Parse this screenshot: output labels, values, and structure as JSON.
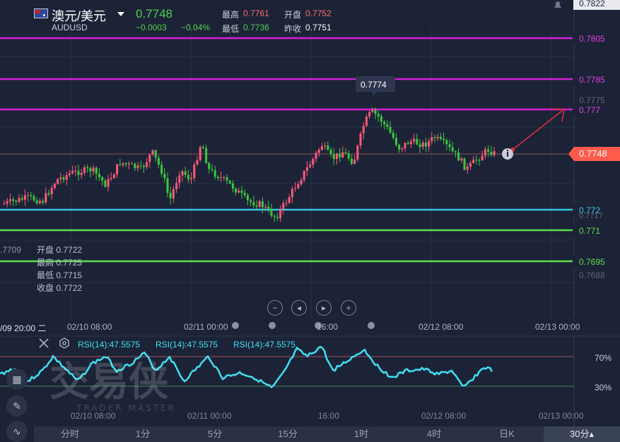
{
  "header": {
    "symbol_name": "澳元/美元",
    "symbol_code": "AUDUSD",
    "price": "0.7748",
    "change": "−0.0003",
    "change_pct": "−0.04%",
    "high_label": "最高",
    "high_value": "0.7761",
    "open_label": "开盘",
    "open_value": "0.7752",
    "low_label": "最低",
    "low_value": "0.7736",
    "prev_close_label": "昨收",
    "prev_close_value": "0.7751"
  },
  "price_axis": {
    "top_label": "0.7822",
    "lines": [
      {
        "label": "0.7805",
        "color": "#d61ed6"
      },
      {
        "label": "0.7785",
        "color": "#d61ed6"
      },
      {
        "label": "0.777",
        "color": "#d61ed6"
      },
      {
        "label": "0.772",
        "color": "#37c8e6"
      },
      {
        "label": "0.771",
        "color": "#5ee04a"
      },
      {
        "label": "0.7695",
        "color": "#5ee04a"
      }
    ],
    "faint_labels": [
      "0.7775",
      "0.7717",
      "0.7688"
    ],
    "current_price": "0.7748",
    "peak_tooltip": "0.7774",
    "left_edge_label": ".7709"
  },
  "ohlc_tooltip": {
    "open": "开盘 0.7722",
    "high": "最高 0.7725",
    "low": "最低 0.7715",
    "close": "收盘 0.7722"
  },
  "time_axis_top": [
    "/09 20:00 二",
    "02/10 08:00",
    "02/11 00:00",
    "16:00",
    "02/12 08:00",
    "02/13 00:00"
  ],
  "time_axis_bottom": [
    "02/10 08:00",
    "02/11 00:00",
    "16:00",
    "02/12 08:00",
    "02/13 00:00"
  ],
  "rsi": {
    "label1": "RSI(14):47.5575",
    "label2": "RSI(14):47.5575",
    "label3": "RSI(14):47.5575",
    "level_high": "70%",
    "level_low": "30%"
  },
  "watermark": {
    "main": "交易侠",
    "sub": "TRADER MASTER"
  },
  "timeframes": [
    "分时",
    "1分",
    "5分",
    "15分",
    "1时",
    "4时",
    "日K",
    "30分▴"
  ],
  "colors": {
    "up": "#ff5a7a",
    "down": "#3cc83c",
    "bg": "#1c2337",
    "accent_badge": "#ff5a4c",
    "rsi": "#3ee0f0"
  }
}
